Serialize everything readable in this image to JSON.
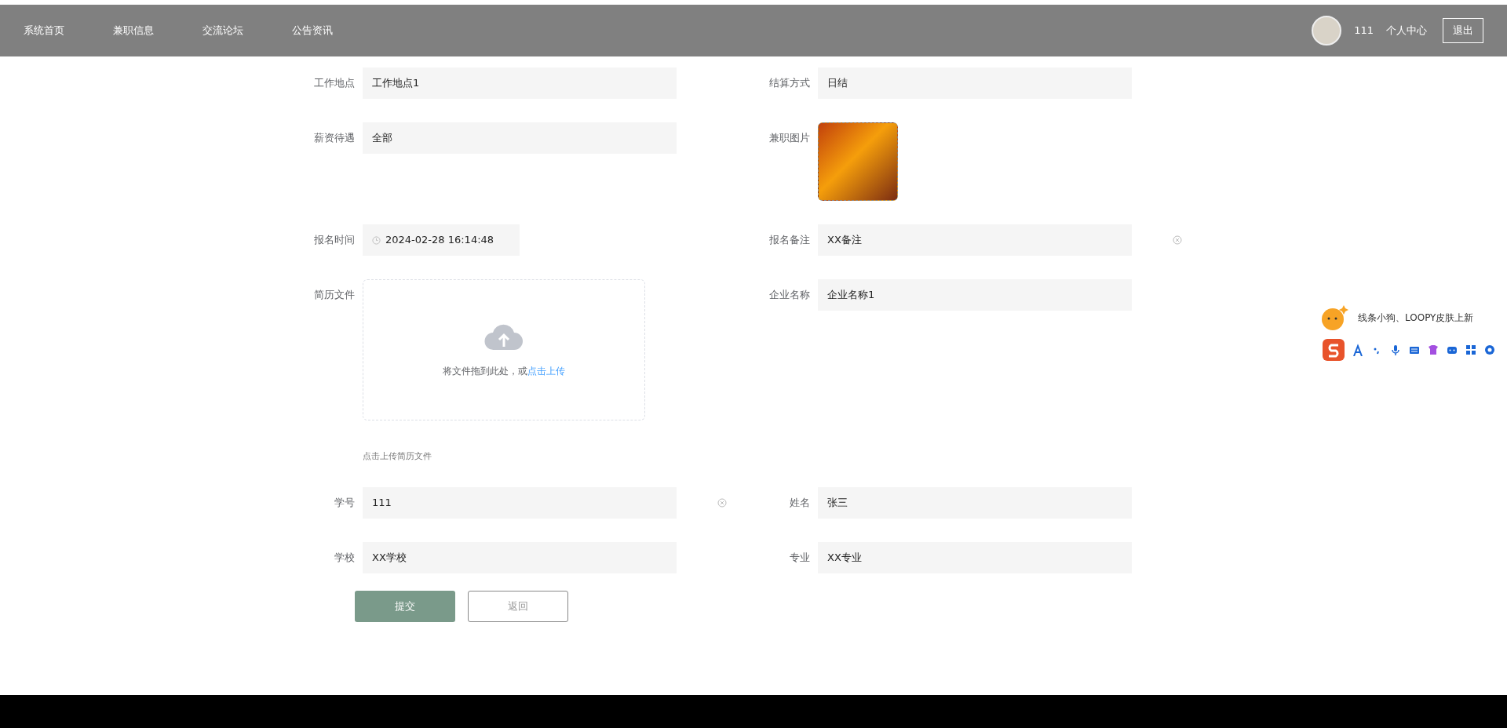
{
  "nav": {
    "items": [
      {
        "label": "系统首页"
      },
      {
        "label": "兼职信息"
      },
      {
        "label": "交流论坛"
      },
      {
        "label": "公告资讯"
      }
    ],
    "user_name": "111",
    "profile_link": "个人中心",
    "logout": "退出"
  },
  "form": {
    "rows": [
      [
        {
          "kind": "text",
          "label": "工作地点",
          "value": "工作地点1",
          "clearable": false
        },
        {
          "kind": "text",
          "label": "结算方式",
          "value": "日结",
          "clearable": false
        }
      ],
      [
        {
          "kind": "text",
          "label": "薪资待遇",
          "value": "全部",
          "clearable": false
        },
        {
          "kind": "image",
          "label": "兼职图片"
        }
      ],
      [
        {
          "kind": "date",
          "label": "报名时间",
          "value": "2024-02-28 16:14:48"
        },
        {
          "kind": "text",
          "label": "报名备注",
          "value": "XX备注",
          "clearable": true
        }
      ],
      [
        {
          "kind": "upload",
          "label": "简历文件",
          "drop_text": "将文件拖到此处，或",
          "link": "点击上传",
          "tip": "点击上传简历文件"
        },
        {
          "kind": "text",
          "label": "企业名称",
          "value": "企业名称1",
          "clearable": false
        }
      ],
      [
        {
          "kind": "text",
          "label": "学号",
          "value": "111",
          "clearable": true
        },
        {
          "kind": "text",
          "label": "姓名",
          "value": "张三",
          "clearable": false
        }
      ],
      [
        {
          "kind": "text",
          "label": "学校",
          "value": "XX学校",
          "clearable": false
        },
        {
          "kind": "text",
          "label": "专业",
          "value": "XX专业",
          "clearable": false
        }
      ]
    ],
    "submit": "提交",
    "back": "返回"
  },
  "ime": {
    "notice": "线条小狗、LOOPY皮肤上新"
  }
}
